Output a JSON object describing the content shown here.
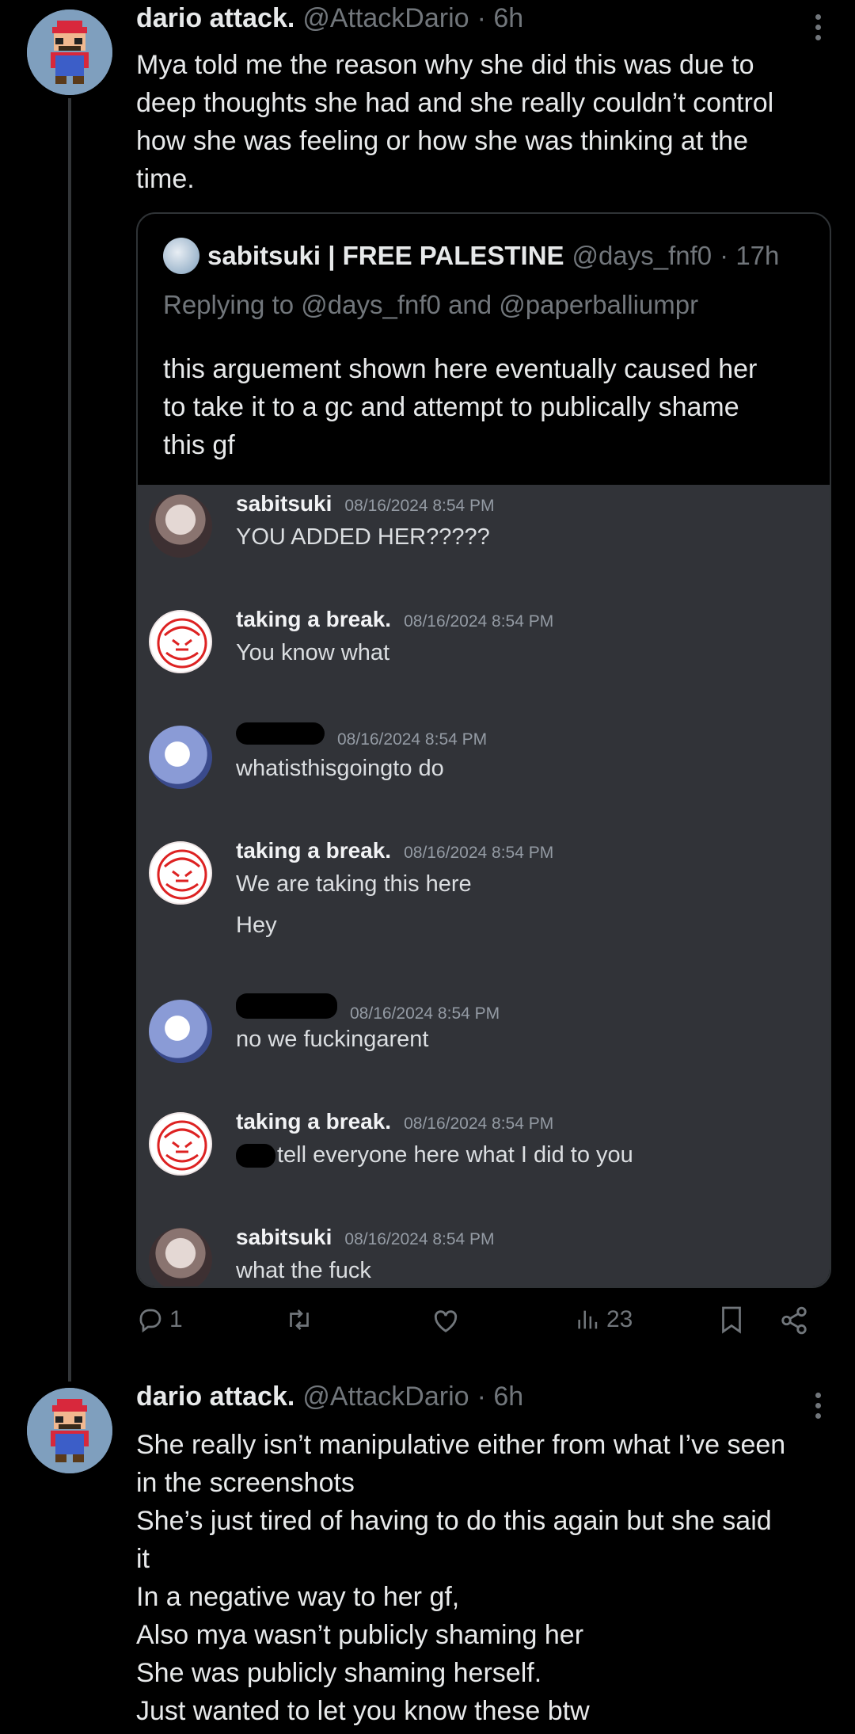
{
  "tweets": [
    {
      "name": "dario attack.",
      "handle": "@AttackDario",
      "time": "· 6h",
      "lines": [
        "Mya told me the reason why she did this was due to",
        "deep thoughts she had and she really couldn’t control",
        "how she was feeling or how she was thinking at the",
        "time."
      ],
      "actions": {
        "replies": "1",
        "views": "23"
      }
    },
    {
      "name": "dario attack.",
      "handle": "@AttackDario",
      "time": "· 6h",
      "lines": [
        "She really isn’t manipulative either from what I’ve seen",
        "in the screenshots",
        "She’s just tired of having to do this again but she said",
        "it",
        "In a negative way to her gf,",
        "Also mya wasn’t publicly shaming her",
        "She was publicly shaming herself.",
        "Just wanted to let you know these btw"
      ]
    }
  ],
  "quote": {
    "name": "sabitsuki | FREE PALESTINE",
    "handle": "@days_fnf0",
    "time": "· 17h",
    "replying_prefix": "Replying to",
    "replying_user1": "@days_fnf0",
    "replying_and": "and",
    "replying_user2": "@paperballiumpr",
    "lines": [
      "this arguement shown here eventually caused her",
      "to take it to a gc and attempt to publically shame",
      "this gf"
    ]
  },
  "discord": {
    "messages": [
      {
        "user": "sabitsuki",
        "time": "08/16/2024 8:54 PM",
        "lines": [
          "YOU ADDED HER?????"
        ]
      },
      {
        "user": "taking a break.",
        "time": "08/16/2024 8:54 PM",
        "lines": [
          "You know what"
        ]
      },
      {
        "user": "",
        "time": "08/16/2024 8:54 PM",
        "lines": [
          "whatisthisgoingto do"
        ]
      },
      {
        "user": "taking a break.",
        "time": "08/16/2024 8:54 PM",
        "lines": [
          "We are taking this here",
          "Hey"
        ]
      },
      {
        "user": "",
        "time": "08/16/2024 8:54 PM",
        "lines": [
          "no we fuckingarent"
        ]
      },
      {
        "user": "taking a break.",
        "time": "08/16/2024 8:54 PM",
        "lines": [
          "tell everyone here what I did to you"
        ]
      },
      {
        "user": "sabitsuki",
        "time": "08/16/2024 8:54 PM",
        "lines": [
          "what the fuck"
        ]
      }
    ]
  },
  "icons": {
    "reply": "reply-icon",
    "retweet": "retweet-icon",
    "like": "heart-icon",
    "views": "views-icon",
    "bookmark": "bookmark-icon",
    "share": "share-icon",
    "more": "more-icon"
  },
  "colors": {
    "background": "#000000",
    "text": "#e7e9ea",
    "muted": "#71767b",
    "discord_bg": "#313338"
  }
}
